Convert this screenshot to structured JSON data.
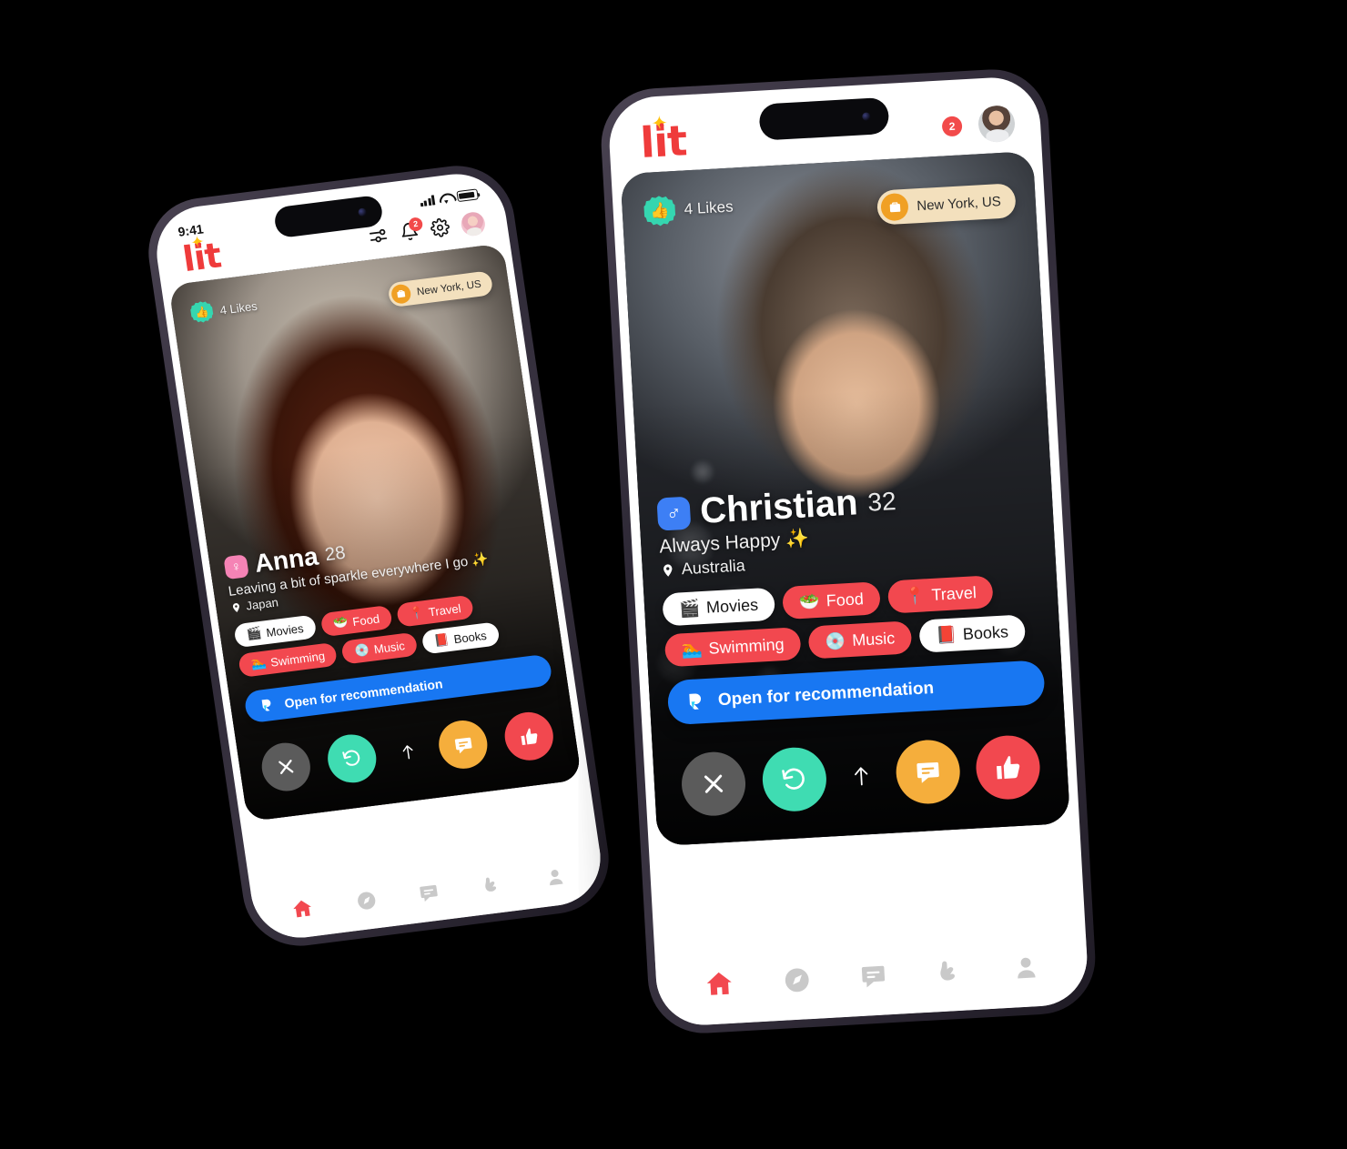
{
  "app": {
    "name": "lit",
    "logo_color": "#ef3b3b",
    "spark_color": "#ffc20e"
  },
  "colors": {
    "accent_red": "#f2484f",
    "blue": "#1877f2",
    "mint": "#3fdcb2",
    "orange": "#f5ae3c",
    "teal_badge": "#35d6b0",
    "location_pill": "#f3e0bd",
    "location_icon": "#f0a024",
    "female_badge": "#f583b5",
    "male_badge": "#3d7ff5"
  },
  "left_phone": {
    "statusbar": {
      "time": "9:41",
      "signal_icon": "cellular-signal-icon",
      "wifi_icon": "wifi-icon",
      "battery_icon": "battery-icon"
    },
    "header": {
      "logo": "lit",
      "filter_icon": "sliders-filter-icon",
      "bell_icon": "bell-notification-icon",
      "bell_badge": "2",
      "settings_icon": "gear-settings-icon",
      "avatar": "user-avatar"
    },
    "card": {
      "likes_text": "4 Likes",
      "likes_icon": "thumbs-up-icon",
      "location_badge": "New York, US",
      "location_badge_icon": "briefcase-icon",
      "gender_symbol": "♀",
      "name": "Anna",
      "age": "28",
      "bio": "Leaving a bit of sparkle everywhere I go ✨",
      "country": "Japan",
      "country_pin_icon": "location-pin-icon",
      "tags": [
        {
          "label": "Movies",
          "emoji": "🎬",
          "selected": true
        },
        {
          "label": "Food",
          "emoji": "🥗",
          "selected": false
        },
        {
          "label": "Travel",
          "emoji": "📍",
          "selected": false
        },
        {
          "label": "Swimming",
          "emoji": "🏊",
          "selected": false
        },
        {
          "label": "Music",
          "emoji": "💿",
          "selected": false
        },
        {
          "label": "Books",
          "emoji": "📕",
          "selected": true
        }
      ],
      "recommendation_label": "Open for recommendation",
      "recommendation_icon": "lit-mark-icon",
      "actions": [
        {
          "name": "close-button",
          "icon": "close-x-icon"
        },
        {
          "name": "undo-button",
          "icon": "undo-rewind-icon"
        },
        {
          "name": "boost-button",
          "icon": "arrow-up-icon"
        },
        {
          "name": "chat-button",
          "icon": "chat-bubble-icon"
        },
        {
          "name": "like-button",
          "icon": "thumbs-up-icon"
        }
      ]
    },
    "bottom_nav": [
      {
        "name": "nav-home",
        "icon": "home-icon",
        "active": true
      },
      {
        "name": "nav-explore",
        "icon": "compass-icon",
        "active": false
      },
      {
        "name": "nav-chat",
        "icon": "chat-bubble-icon",
        "active": false
      },
      {
        "name": "nav-matches",
        "icon": "hand-gesture-icon",
        "active": false
      },
      {
        "name": "nav-profile",
        "icon": "person-icon",
        "active": false
      }
    ]
  },
  "right_phone": {
    "header": {
      "logo": "lit",
      "notification_badge": "2",
      "avatar": "user-avatar"
    },
    "card": {
      "likes_text": "4 Likes",
      "likes_icon": "thumbs-up-icon",
      "location_badge": "New York, US",
      "location_badge_icon": "briefcase-icon",
      "gender_symbol": "♂",
      "name": "Christian",
      "age": "32",
      "bio": "Always Happy ✨",
      "country": "Australia",
      "country_pin_icon": "location-pin-icon",
      "tags": [
        {
          "label": "Movies",
          "emoji": "🎬",
          "selected": true
        },
        {
          "label": "Food",
          "emoji": "🥗",
          "selected": false
        },
        {
          "label": "Travel",
          "emoji": "📍",
          "selected": false
        },
        {
          "label": "Swimming",
          "emoji": "🏊",
          "selected": false
        },
        {
          "label": "Music",
          "emoji": "💿",
          "selected": false
        },
        {
          "label": "Books",
          "emoji": "📕",
          "selected": true
        }
      ],
      "recommendation_label": "Open for recommendation",
      "recommendation_icon": "lit-mark-icon",
      "actions": [
        {
          "name": "close-button",
          "icon": "close-x-icon"
        },
        {
          "name": "undo-button",
          "icon": "undo-rewind-icon"
        },
        {
          "name": "boost-button",
          "icon": "arrow-up-icon"
        },
        {
          "name": "chat-button",
          "icon": "chat-bubble-icon"
        },
        {
          "name": "like-button",
          "icon": "thumbs-up-icon"
        }
      ]
    },
    "bottom_nav": [
      {
        "name": "nav-home",
        "icon": "home-icon",
        "active": true
      },
      {
        "name": "nav-explore",
        "icon": "compass-icon",
        "active": false
      },
      {
        "name": "nav-chat",
        "icon": "chat-bubble-icon",
        "active": false
      },
      {
        "name": "nav-matches",
        "icon": "hand-gesture-icon",
        "active": false
      },
      {
        "name": "nav-profile",
        "icon": "person-icon",
        "active": false
      }
    ]
  }
}
